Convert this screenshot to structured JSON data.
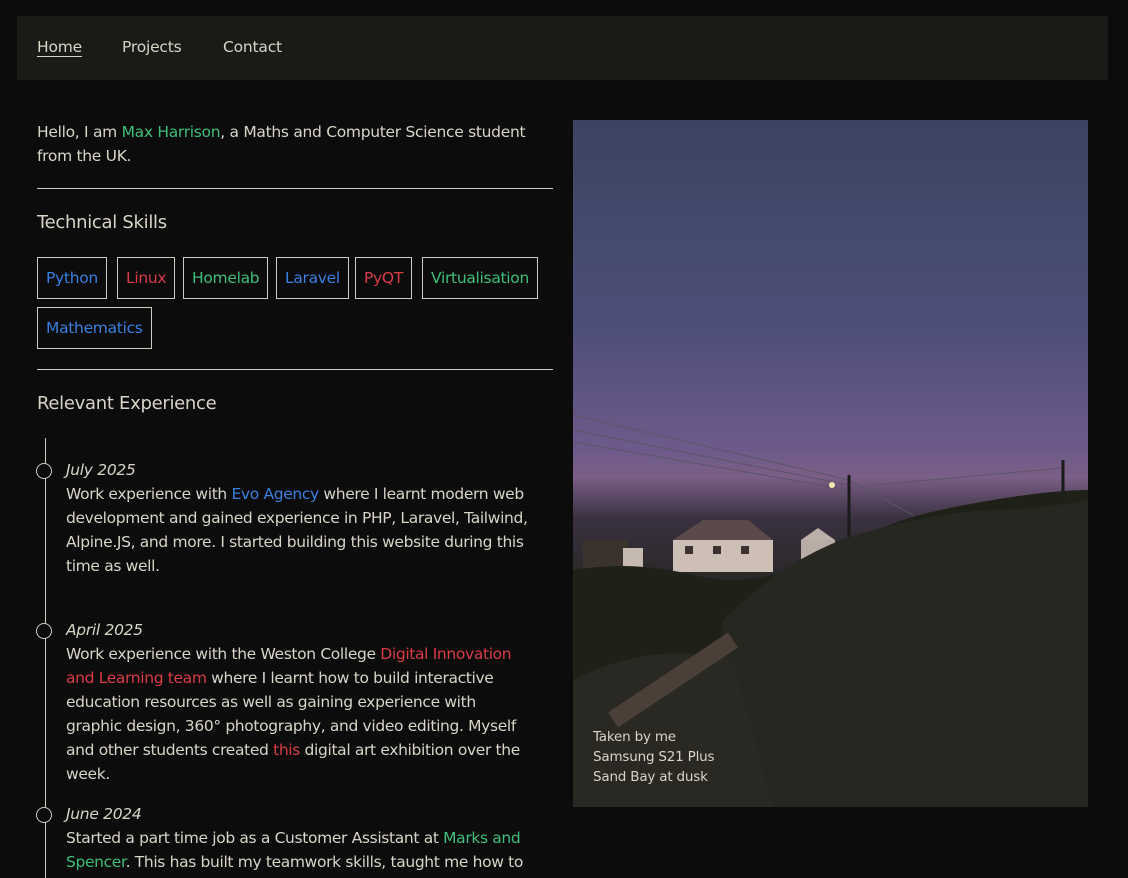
{
  "nav": {
    "items": [
      {
        "label": "Home",
        "active": true
      },
      {
        "label": "Projects",
        "active": false
      },
      {
        "label": "Contact",
        "active": false
      }
    ]
  },
  "intro": {
    "before": "Hello, I am ",
    "name": "Max Harrison",
    "after": ", a Maths and Computer Science student from the UK."
  },
  "skills": {
    "heading": "Technical Skills",
    "items": [
      {
        "label": "Python",
        "color": "#3b7fe0"
      },
      {
        "label": "Linux",
        "color": "#d93c47"
      },
      {
        "label": "Homelab",
        "color": "#3fbf7a"
      },
      {
        "label": "Laravel",
        "color": "#3b7fe0"
      },
      {
        "label": "PyQT",
        "color": "#d93c47"
      },
      {
        "label": "Virtualisation",
        "color": "#3fbf7a"
      },
      {
        "label": "Mathematics",
        "color": "#3b7fe0"
      }
    ]
  },
  "experience": {
    "heading": "Relevant Experience",
    "items": [
      {
        "date": "July 2025",
        "t1": "Work experience with ",
        "link": "Evo Agency",
        "t2": " where I learnt modern web development and gained experience in PHP, Laravel, Tailwind, Alpine.JS, and more. I started building this website during this time as well."
      },
      {
        "date": "April 2025",
        "t1": "Work experience with the Weston College ",
        "link": "Digital Innovation and Learning team",
        "t2": " where I learnt how to build interactive education resources as well as gaining experience with graphic design, 360° photography, and video editing. Myself and other students created ",
        "link2": "this",
        "t3": " digital art exhibition over the week."
      },
      {
        "date": "June 2024",
        "t1": "Started a part time job as a Customer Assistant at ",
        "link": "Marks and Spencer",
        "t2": ". This has built my teamwork skills, taught me how to"
      }
    ]
  },
  "photo": {
    "caption_line1": "Taken by me",
    "caption_line2": "Samsung S21 Plus",
    "caption_line3": "Sand Bay at dusk"
  },
  "colors": {
    "background": "#0c0c0c",
    "nav_bg": "#1a1b16",
    "green": "#3fbf7a",
    "blue": "#3b7fe0",
    "red": "#d93c47"
  }
}
